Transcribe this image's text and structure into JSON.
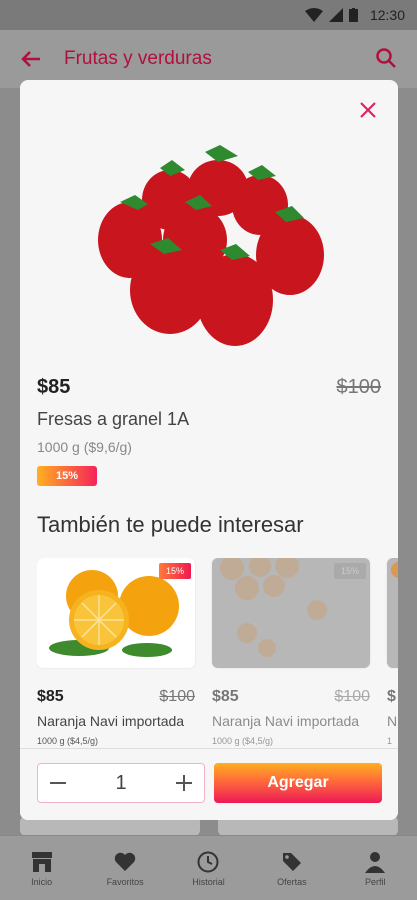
{
  "status_bar": {
    "time": "12:30"
  },
  "app_bar": {
    "title": "Frutas y verduras"
  },
  "product": {
    "price": "$85",
    "old_price": "$100",
    "name": "Fresas a granel 1A",
    "weight": "1000 g ($9,6/g)",
    "discount": "15%"
  },
  "recommendations": {
    "title": "También te puede interesar",
    "items": [
      {
        "price": "$85",
        "old_price": "$100",
        "name": "Naranja Navi importada",
        "weight": "1000 g ($4,5/g)",
        "discount": "15%"
      },
      {
        "price": "$85",
        "old_price": "$100",
        "name": "Naranja Navi importada",
        "weight": "1000 g ($4,5/g)",
        "discount": "15%"
      },
      {
        "price": "$",
        "old_price": "",
        "name": "N",
        "weight": "1",
        "discount": ""
      }
    ]
  },
  "footer": {
    "quantity": "1",
    "add_label": "Agregar"
  },
  "bottom_nav": [
    {
      "label": "Inicio",
      "icon": "store-icon"
    },
    {
      "label": "Favoritos",
      "icon": "heart-icon"
    },
    {
      "label": "Historial",
      "icon": "clock-icon"
    },
    {
      "label": "Ofertas",
      "icon": "tag-icon"
    },
    {
      "label": "Perfil",
      "icon": "person-icon"
    }
  ],
  "colors": {
    "accent": "#b0103e",
    "gradient_start": "#ffb020",
    "gradient_end": "#ec1a56"
  }
}
